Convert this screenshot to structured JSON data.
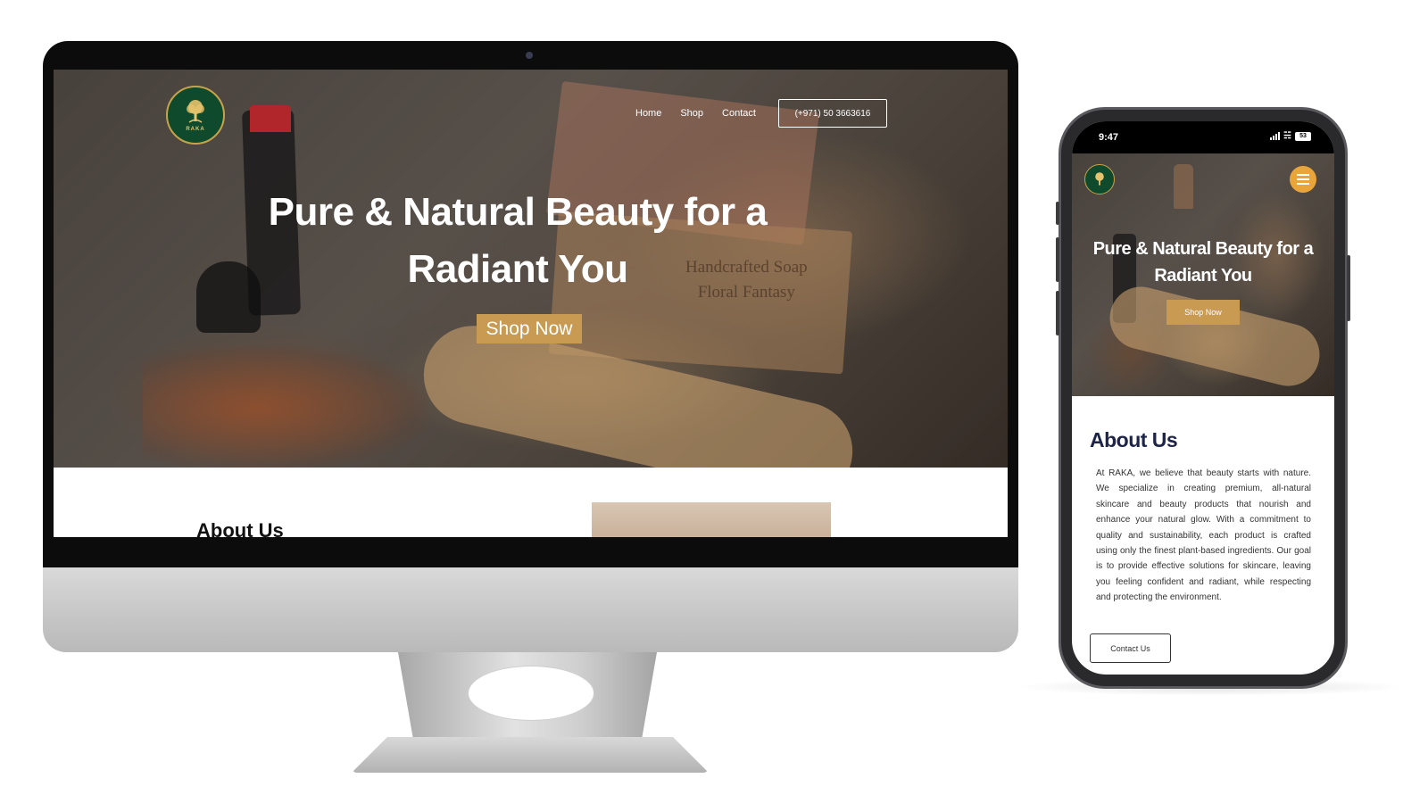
{
  "desktop": {
    "nav": {
      "home": "Home",
      "shop": "Shop",
      "contact": "Contact",
      "phone": "(+971) 50 3663616"
    },
    "hero": {
      "title_line1": "Pure & Natural Beauty for a",
      "title_line2": "Radiant You",
      "cta": "Shop Now"
    },
    "about_peek": "About Us",
    "product_label_line1": "Handcrafted Soap",
    "product_label_line2": "Floral Fantasy"
  },
  "brand": {
    "logo_word": "RAKA",
    "logo_icon": "tree-icon",
    "green": "#0f4a2c",
    "gold": "#c99a52"
  },
  "mobile": {
    "status": {
      "time": "9:47",
      "battery": "53"
    },
    "hero": {
      "title_line1": "Pure & Natural Beauty for a",
      "title_line2": "Radiant You",
      "cta": "Shop Now"
    },
    "menu_icon": "hamburger-icon",
    "about": {
      "title": "About Us",
      "body": "At RAKA, we believe that beauty starts with nature. We specialize in creating premium, all-natural skincare and beauty products that nourish and enhance your natural glow. With a commitment to quality and sustainability, each product is crafted using only the finest plant-based ingredients. Our goal is to provide effective solutions for skincare, leaving you feeling confident and radiant, while respecting and protecting the environment.",
      "contact_button": "Contact Us"
    }
  }
}
